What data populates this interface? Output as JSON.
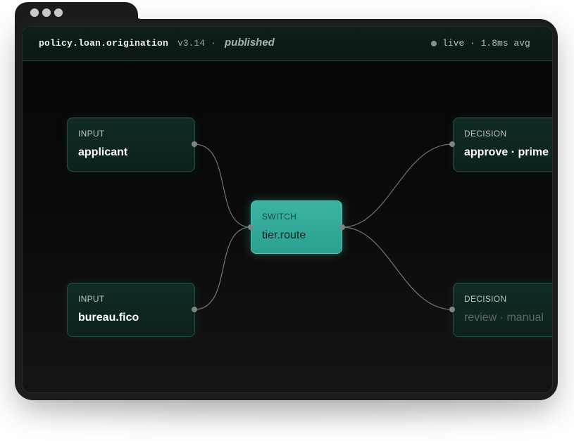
{
  "window": {
    "title_name": "policy.loan.origination",
    "version": "v3.14",
    "separator": "·",
    "status": "published",
    "live_text": "live · 1.8ms avg"
  },
  "nodes": {
    "applicant": {
      "kind": "INPUT",
      "label": "applicant"
    },
    "bureau": {
      "kind": "INPUT",
      "label": "bureau.fico"
    },
    "switch": {
      "kind": "SWITCH",
      "label": "tier.route"
    },
    "approve": {
      "kind": "DECISION",
      "label": "approve · prime"
    },
    "review": {
      "kind": "DECISION",
      "label": "review · manual"
    }
  },
  "edges": [
    {
      "from": "applicant",
      "to": "switch"
    },
    {
      "from": "bureau",
      "to": "switch"
    },
    {
      "from": "switch",
      "to": "approve"
    },
    {
      "from": "switch",
      "to": "review"
    }
  ],
  "colors": {
    "accent": "#2aa090",
    "node_bg": "#0c211e",
    "node_border": "#1f4d45",
    "edge": "#6f7876"
  }
}
